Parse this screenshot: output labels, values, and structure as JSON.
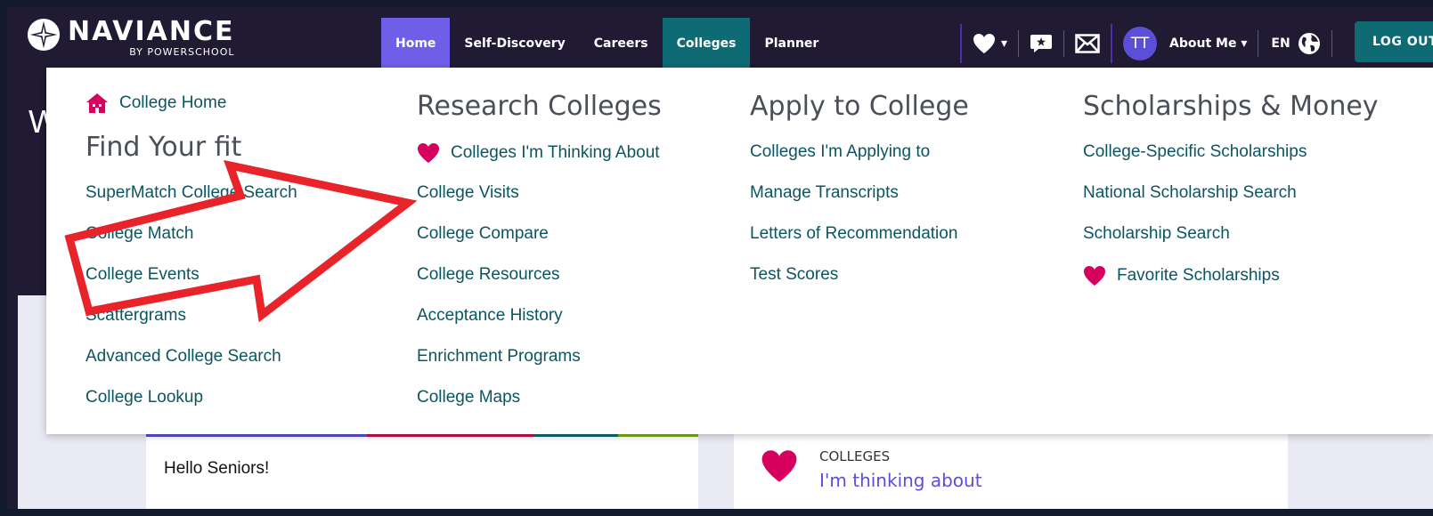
{
  "brand": {
    "title": "NAVIANCE",
    "subtitle": "BY POWERSCHOOL"
  },
  "nav": {
    "tabs": [
      {
        "label": "Home"
      },
      {
        "label": "Self-Discovery"
      },
      {
        "label": "Careers"
      },
      {
        "label": "Colleges"
      },
      {
        "label": "Planner"
      }
    ],
    "user_initials": "TT",
    "about_label": "About Me ▾",
    "favorites_caret": "▾",
    "lang": "EN",
    "logout_label": "LOG OUT"
  },
  "hero": {
    "partial_heading": "W"
  },
  "menu": {
    "col1": {
      "home_label": "College Home",
      "heading": "Find Your fit",
      "links": [
        "SuperMatch College Search",
        "College Match",
        "College Events",
        "Scattergrams",
        "Advanced College Search",
        "College Lookup"
      ]
    },
    "col2": {
      "heading": "Research Colleges",
      "fav_label": "Colleges I'm Thinking About",
      "links": [
        "College Visits",
        "College Compare",
        "College Resources",
        "Acceptance History",
        "Enrichment Programs",
        "College Maps"
      ]
    },
    "col3": {
      "heading": "Apply to College",
      "links": [
        "Colleges I'm Applying to",
        "Manage Transcripts",
        "Letters of Recommendation",
        "Test Scores"
      ]
    },
    "col4": {
      "heading": "Scholarships & Money",
      "links": [
        "College-Specific Scholarships",
        "National Scholarship Search",
        "Scholarship Search"
      ],
      "fav_label": "Favorite Scholarships"
    }
  },
  "cards": {
    "announcement": "Hello Seniors!",
    "colleges_caption": "COLLEGES",
    "colleges_link": "I'm thinking about"
  },
  "colors": {
    "navy": "#201a33",
    "home_tab": "#6f5fe8",
    "teal": "#0e6b74",
    "link": "#0b5560",
    "heart": "#d6005f",
    "arrow": "#e8232a"
  }
}
